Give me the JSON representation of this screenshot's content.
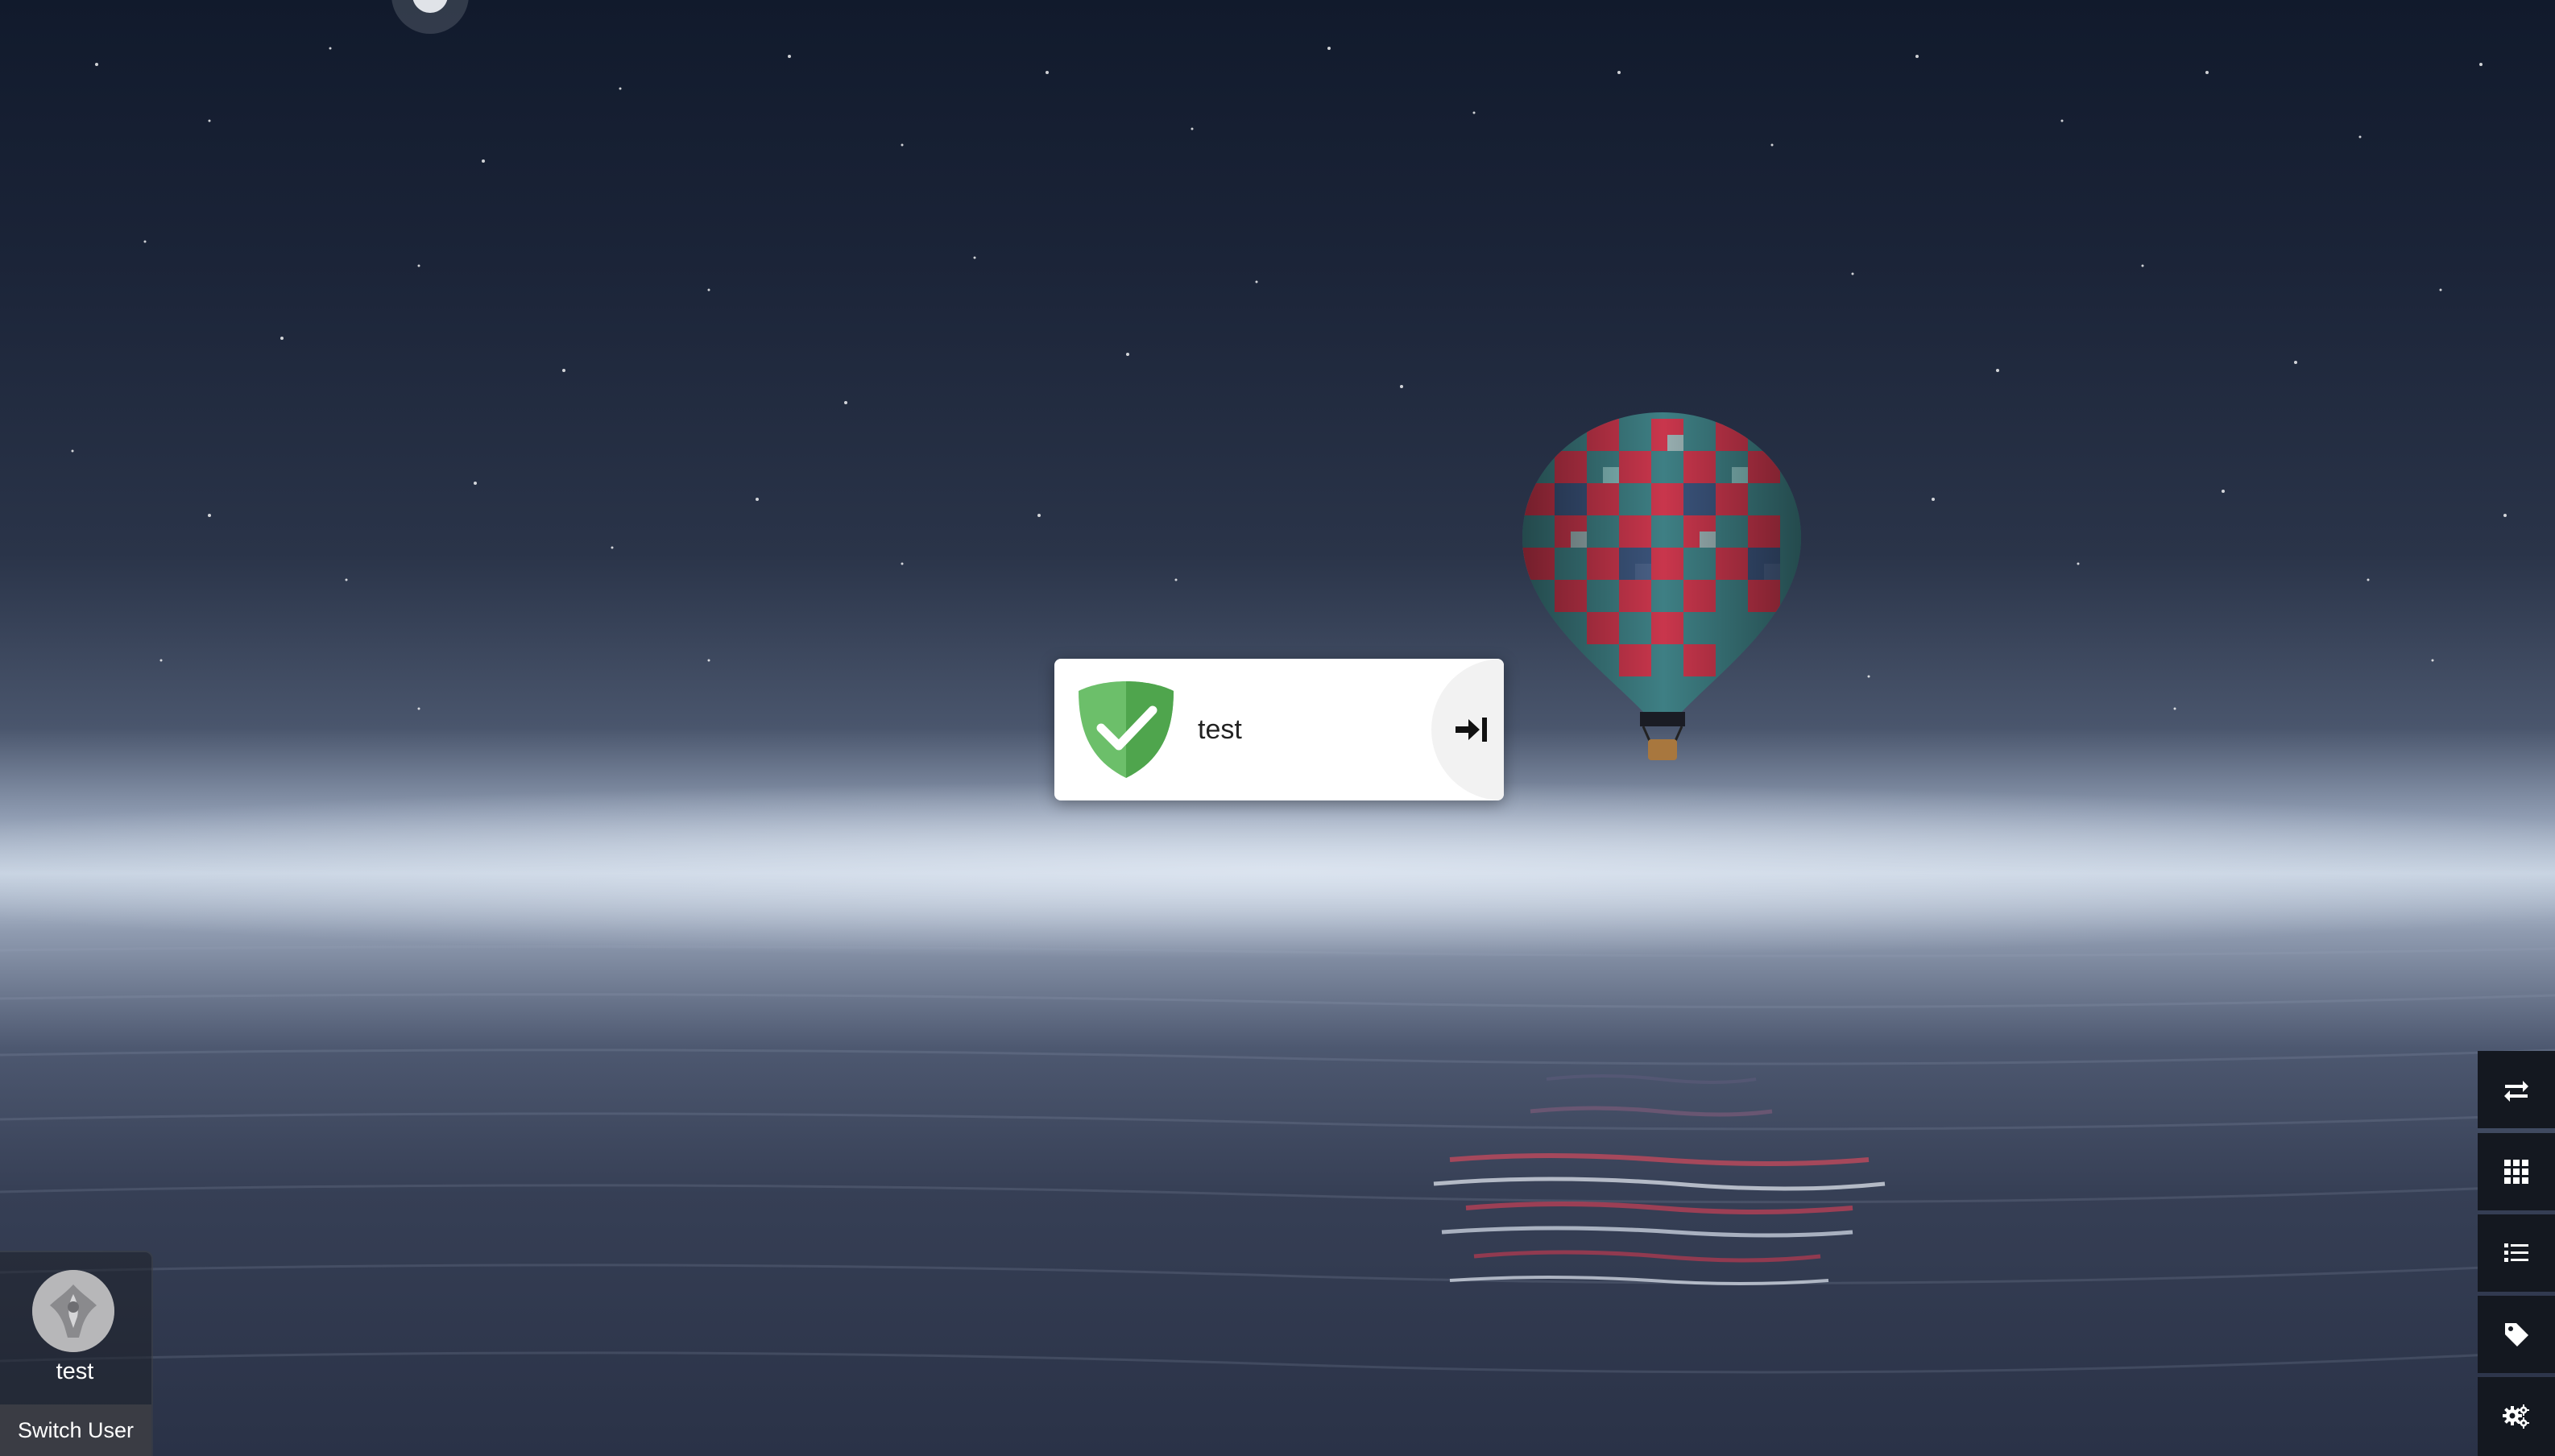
{
  "login_tile": {
    "username": "test",
    "logo_icon": "shield-check-icon",
    "enter_icon": "arrow-to-right-icon"
  },
  "user_panel": {
    "name": "test",
    "avatar_icon": "user-avatar-icon",
    "switch_user_label": "Switch User"
  },
  "toolbar": [
    {
      "icon": "exchange-icon"
    },
    {
      "icon": "grid-icon"
    },
    {
      "icon": "list-icon"
    },
    {
      "icon": "tag-icon"
    },
    {
      "icon": "gears-icon"
    }
  ],
  "colors": {
    "shield_green": "#6cbf6a",
    "shield_dark_green": "#4fa54d",
    "toolbar_bg": "#141820"
  }
}
